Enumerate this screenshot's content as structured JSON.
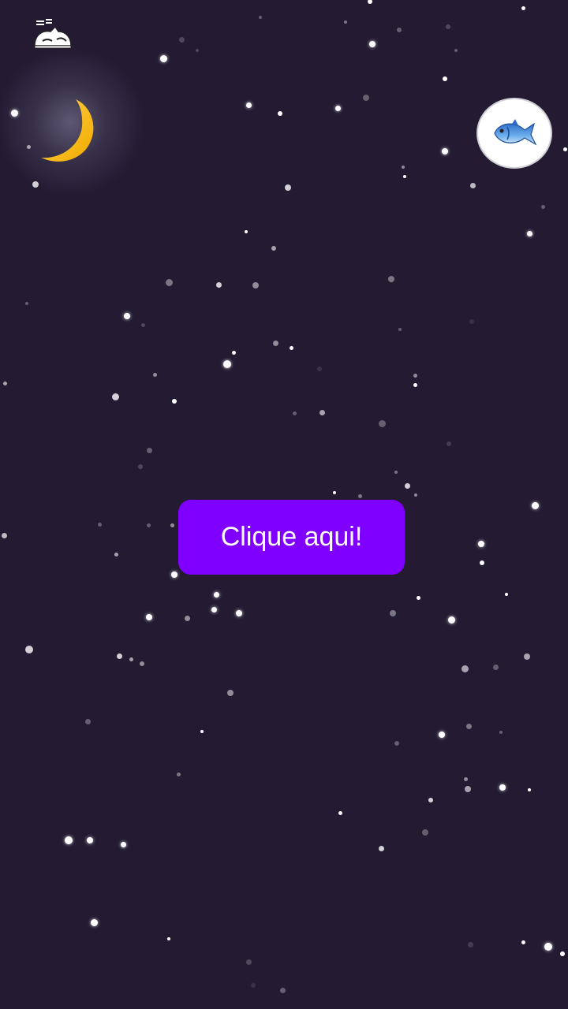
{
  "app": {
    "background_color": "#241b33",
    "accent_color": "#7f00ff"
  },
  "icons": {
    "top_left": "sleeping-cat-icon",
    "moon": "crescent-moon-icon",
    "fish": "fish-icon"
  },
  "main": {
    "button_label": "Clique aqui!"
  }
}
